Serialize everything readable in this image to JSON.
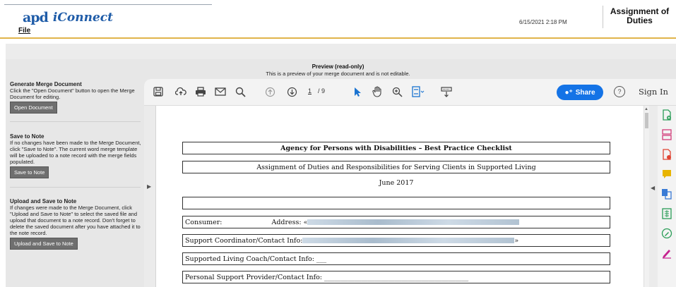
{
  "header": {
    "logo_mark": "apd",
    "logo_text": "iConnect",
    "menu_file": "File",
    "datetime": "6/15/2021 2:18 PM",
    "page_title": "Assignment of Duties"
  },
  "preview": {
    "title": "Preview (read-only)",
    "subtitle": "This is a preview of your merge document and is not editable."
  },
  "left_panel": {
    "generate": {
      "title": "Generate Merge Document",
      "description": "Click the \"Open Document\" button to open the Merge Document for editing.",
      "button": "Open Document"
    },
    "save": {
      "title": "Save to Note",
      "description": "If no changes have been made to the Merge Document, click \"Save to Note\". The current word merge template will be uploaded to a note record with the merge fields populated.",
      "button": "Save to Note"
    },
    "upload": {
      "title": "Upload and Save to Note",
      "description": "If changes were made to the Merge Document, click \"Upload and Save to Note\" to select the saved file and upload that document to a note record. Don't forget to delete the saved document after you have attached it to the note record.",
      "button": "Upload and Save to Note"
    }
  },
  "viewer": {
    "page_current": "1",
    "page_total": "/ 9",
    "share_label": "Share",
    "help_label": "?",
    "sign_in": "Sign In",
    "icons": [
      "save-icon",
      "upload-cloud-icon",
      "print-icon",
      "email-icon",
      "search-icon",
      "prev-page-icon",
      "next-page-icon",
      "cursor-icon",
      "hand-icon",
      "zoom-in-icon",
      "fit-page-icon",
      "more-tools-icon"
    ],
    "tools": [
      {
        "icon": "create-pdf-icon",
        "color": "#2a9d57"
      },
      {
        "icon": "organize-pages-icon",
        "color": "#d23d7a"
      },
      {
        "icon": "export-pdf-icon",
        "color": "#e04433"
      },
      {
        "icon": "comment-icon",
        "color": "#e8b400"
      },
      {
        "icon": "combine-files-icon",
        "color": "#3a7bd5"
      },
      {
        "icon": "excel-export-icon",
        "color": "#2a9d57"
      },
      {
        "icon": "edit-pdf-icon",
        "color": "#2a9d57"
      },
      {
        "icon": "fill-sign-icon",
        "color": "#c6238f"
      }
    ]
  },
  "document": {
    "heading": "Agency for Persons with Disabilities – Best Practice Checklist",
    "subheading": "Assignment of Duties and Responsibilities for Serving Clients in Supported Living",
    "date": "June 2017",
    "consumer_label": "Consumer:",
    "address_label": "Address: «",
    "coordinator_label": "Support Coordinator/Contact Info:",
    "coordinator_tail": "»",
    "coach_label": "Supported Living Coach/Contact Info: ___",
    "provider_label": "Personal Support Provider/Contact Info: ___________________________________________"
  }
}
